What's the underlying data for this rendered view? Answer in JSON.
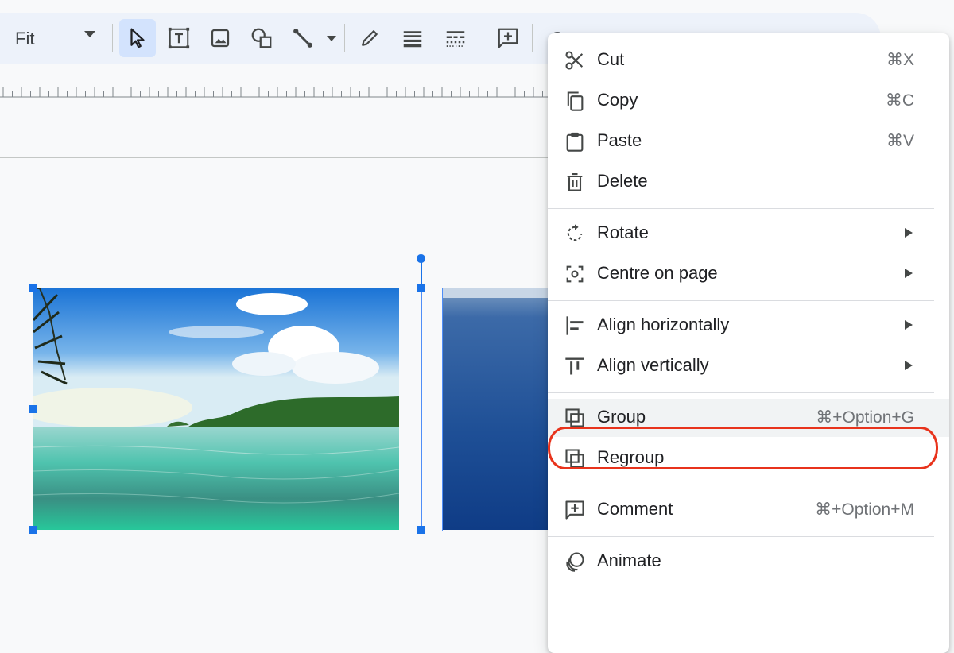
{
  "toolbar": {
    "zoom_label": "Fit",
    "tools": [
      {
        "name": "select-tool",
        "icon": "cursor-arrow-icon",
        "active": true
      },
      {
        "name": "text-box-tool",
        "icon": "text-box-icon"
      },
      {
        "name": "image-tool",
        "icon": "image-icon"
      },
      {
        "name": "shape-tool",
        "icon": "shapes-icon"
      },
      {
        "name": "line-tool",
        "icon": "line-icon"
      },
      {
        "name": "border-color-tool",
        "icon": "pencil-icon"
      },
      {
        "name": "border-weight-tool",
        "icon": "border-weight-icon"
      },
      {
        "name": "border-dash-tool",
        "icon": "border-dash-icon"
      },
      {
        "name": "comment-tool",
        "icon": "add-comment-icon"
      }
    ]
  },
  "context_menu": {
    "sections": [
      [
        {
          "label": "Cut",
          "shortcut": "⌘X",
          "icon": "scissors-icon"
        },
        {
          "label": "Copy",
          "shortcut": "⌘C",
          "icon": "copy-icon"
        },
        {
          "label": "Paste",
          "shortcut": "⌘V",
          "icon": "clipboard-icon"
        },
        {
          "label": "Delete",
          "shortcut": "",
          "icon": "trash-icon"
        }
      ],
      [
        {
          "label": "Rotate",
          "submenu": true,
          "icon": "rotate-icon"
        },
        {
          "label": "Centre on page",
          "submenu": true,
          "icon": "center-focus-icon"
        }
      ],
      [
        {
          "label": "Align horizontally",
          "submenu": true,
          "icon": "align-horizontal-icon"
        },
        {
          "label": "Align vertically",
          "submenu": true,
          "icon": "align-vertical-icon"
        }
      ],
      [
        {
          "label": "Group",
          "shortcut": "⌘+Option+G",
          "icon": "group-icon",
          "highlighted": true
        },
        {
          "label": "Regroup",
          "shortcut": "",
          "icon": "regroup-icon"
        }
      ],
      [
        {
          "label": "Comment",
          "shortcut": "⌘+Option+M",
          "icon": "add-comment-icon"
        }
      ],
      [
        {
          "label": "Animate",
          "shortcut": "",
          "icon": "animate-icon"
        }
      ]
    ]
  },
  "colors": {
    "selection": "#1a73e8",
    "annotation": "#e8331c",
    "toolbar_bg": "#edf2fa"
  }
}
